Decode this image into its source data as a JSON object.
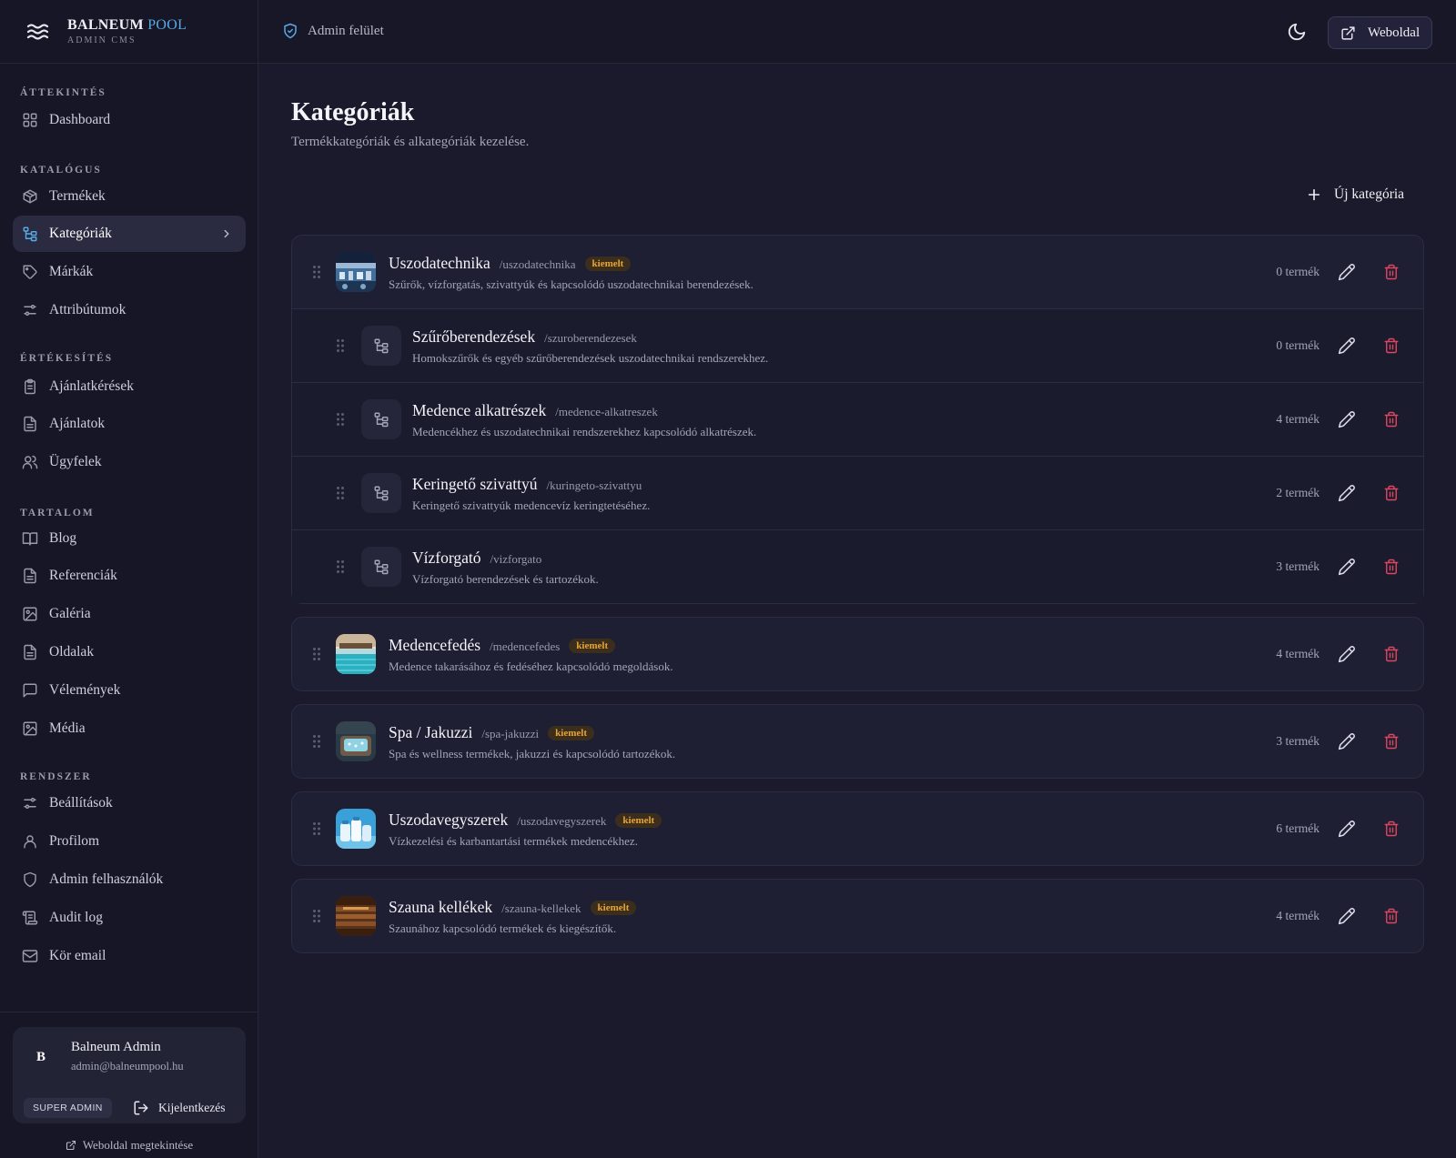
{
  "brand": {
    "name_main": "BALNEUM",
    "name_accent": "POOL",
    "subtitle": "ADMIN CMS"
  },
  "topbar": {
    "breadcrumb": "Admin felület",
    "site_button": "Weboldal"
  },
  "sidebar": {
    "sections": [
      {
        "title": "ÁTTEKINTÉS",
        "items": [
          {
            "label": "Dashboard",
            "icon": "dashboard-icon"
          }
        ]
      },
      {
        "title": "KATALÓGUS",
        "items": [
          {
            "label": "Termékek",
            "icon": "box-icon"
          },
          {
            "label": "Kategóriák",
            "icon": "tree-icon",
            "active": true
          },
          {
            "label": "Márkák",
            "icon": "tag-icon"
          },
          {
            "label": "Attribútumok",
            "icon": "sliders-icon"
          }
        ]
      },
      {
        "title": "ÉRTÉKESÍTÉS",
        "items": [
          {
            "label": "Ajánlatkérések",
            "icon": "clipboard-icon"
          },
          {
            "label": "Ajánlatok",
            "icon": "document-icon"
          },
          {
            "label": "Ügyfelek",
            "icon": "users-icon"
          }
        ]
      },
      {
        "title": "TARTALOM",
        "items": [
          {
            "label": "Blog",
            "icon": "book-icon"
          },
          {
            "label": "Referenciák",
            "icon": "document-icon"
          },
          {
            "label": "Galéria",
            "icon": "image-icon"
          },
          {
            "label": "Oldalak",
            "icon": "document-icon"
          },
          {
            "label": "Vélemények",
            "icon": "message-icon"
          },
          {
            "label": "Média",
            "icon": "image-icon"
          }
        ]
      },
      {
        "title": "RENDSZER",
        "items": [
          {
            "label": "Beállítások",
            "icon": "sliders-icon"
          },
          {
            "label": "Profilom",
            "icon": "user-icon"
          },
          {
            "label": "Admin felhasználók",
            "icon": "shield-icon"
          },
          {
            "label": "Audit log",
            "icon": "log-icon"
          },
          {
            "label": "Kör email",
            "icon": "mail-icon"
          }
        ]
      }
    ]
  },
  "user": {
    "initial": "B",
    "name": "Balneum Admin",
    "email": "admin@balneumpool.hu",
    "role": "SUPER ADMIN",
    "logout_label": "Kijelentkezés",
    "view_site_label": "Weboldal megtekintése"
  },
  "page": {
    "title": "Kategóriák",
    "subtitle": "Termékkategóriák és alkategóriák kezelése.",
    "new_button": "Új kategória"
  },
  "categories": [
    {
      "name": "Uszodatechnika",
      "slug": "/uszodatechnika",
      "badge": "kiemelt",
      "description": "Szűrők, vízforgatás, szivattyúk és kapcsolódó uszodatechnikai berendezések.",
      "count": "0 termék",
      "thumb": "pool-tech",
      "children": [
        {
          "name": "Szűrőberendezések",
          "slug": "/szuroberendezesek",
          "description": "Homokszűrők és egyéb szűrőberendezések uszodatechnikai rendszerekhez.",
          "count": "0 termék"
        },
        {
          "name": "Medence alkatrészek",
          "slug": "/medence-alkatreszek",
          "description": "Medencékhez és uszodatechnikai rendszerekhez kapcsolódó alkatrészek.",
          "count": "4 termék"
        },
        {
          "name": "Keringető szivattyú",
          "slug": "/kuringeto-szivattyu",
          "description": "Keringető szivattyúk medencevíz keringtetéséhez.",
          "count": "2 termék"
        },
        {
          "name": "Vízforgató",
          "slug": "/vizforgato",
          "description": "Vízforgató berendezések és tartozékok.",
          "count": "3 termék"
        }
      ]
    },
    {
      "name": "Medencefedés",
      "slug": "/medencefedes",
      "badge": "kiemelt",
      "description": "Medence takarásához és fedéséhez kapcsolódó megoldások.",
      "count": "4 termék",
      "thumb": "pool-cover",
      "children": []
    },
    {
      "name": "Spa / Jakuzzi",
      "slug": "/spa-jakuzzi",
      "badge": "kiemelt",
      "description": "Spa és wellness termékek, jakuzzi és kapcsolódó tartozékok.",
      "count": "3 termék",
      "thumb": "spa",
      "children": []
    },
    {
      "name": "Uszodavegyszerek",
      "slug": "/uszodavegyszerek",
      "badge": "kiemelt",
      "description": "Vízkezelési és karbantartási termékek medencékhez.",
      "count": "6 termék",
      "thumb": "chemicals",
      "children": []
    },
    {
      "name": "Szauna kellékek",
      "slug": "/szauna-kellekek",
      "badge": "kiemelt",
      "description": "Szaunához kapcsolódó termékek és kiegészítők.",
      "count": "4 termék",
      "thumb": "sauna",
      "children": []
    }
  ],
  "colors": {
    "accent": "#5aa9e6",
    "badge_text": "#e8a431",
    "delete": "#e0455e",
    "background": "#1a1a2c"
  }
}
